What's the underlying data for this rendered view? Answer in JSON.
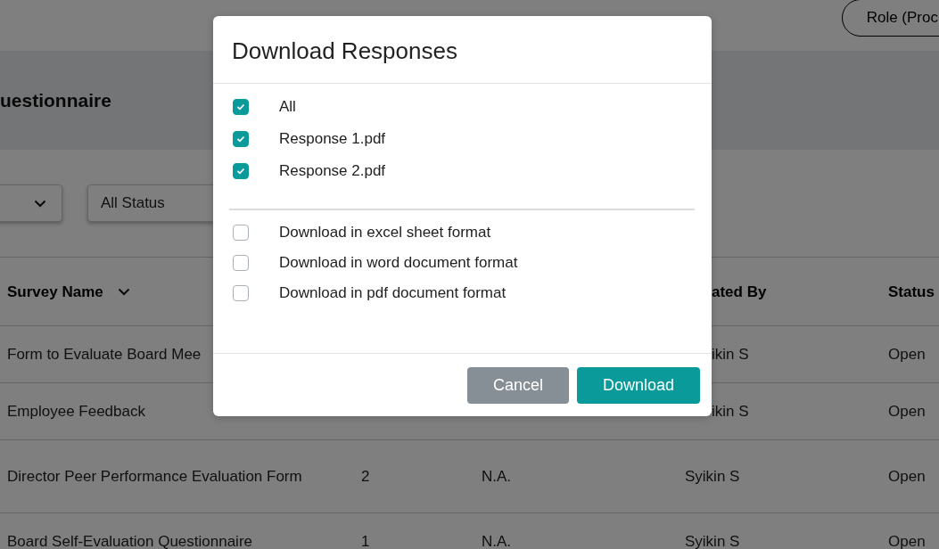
{
  "header": {
    "role_button": "Role (Proc",
    "title": "uestionnaire"
  },
  "filters": {
    "status": "All Status"
  },
  "table": {
    "columns": [
      {
        "label": "Survey Name",
        "sortable": true
      },
      {},
      {},
      {
        "label": "ated By"
      },
      {
        "label": "Status"
      }
    ],
    "rows": [
      {
        "cells": [
          "Form to Evaluate Board Mee",
          null,
          null,
          "ikin S",
          "Open"
        ]
      },
      {
        "cells": [
          "Employee Feedback",
          null,
          null,
          "ikin S",
          "Open"
        ]
      },
      {
        "cells": [
          "Director Peer Performance Evaluation Form",
          "2",
          "N.A.",
          "Syikin S",
          "Open"
        ]
      },
      {
        "cells": [
          "Board Self-Evaluation Questionnaire",
          "1",
          "N.A.",
          "Syikin S",
          "Open"
        ]
      }
    ]
  },
  "dialog": {
    "title": "Download Responses",
    "files": [
      {
        "label": "All",
        "checked": true
      },
      {
        "label": "Response 1.pdf",
        "checked": true
      },
      {
        "label": "Response 2.pdf",
        "checked": true
      }
    ],
    "formats": [
      {
        "label": "Download in excel sheet format",
        "checked": false
      },
      {
        "label": "Download in word document format",
        "checked": false
      },
      {
        "label": "Download in pdf document format",
        "checked": false
      }
    ],
    "buttons": [
      {
        "label": "Cancel",
        "kind": "secondary"
      },
      {
        "label": "Download",
        "kind": "primary"
      }
    ]
  }
}
